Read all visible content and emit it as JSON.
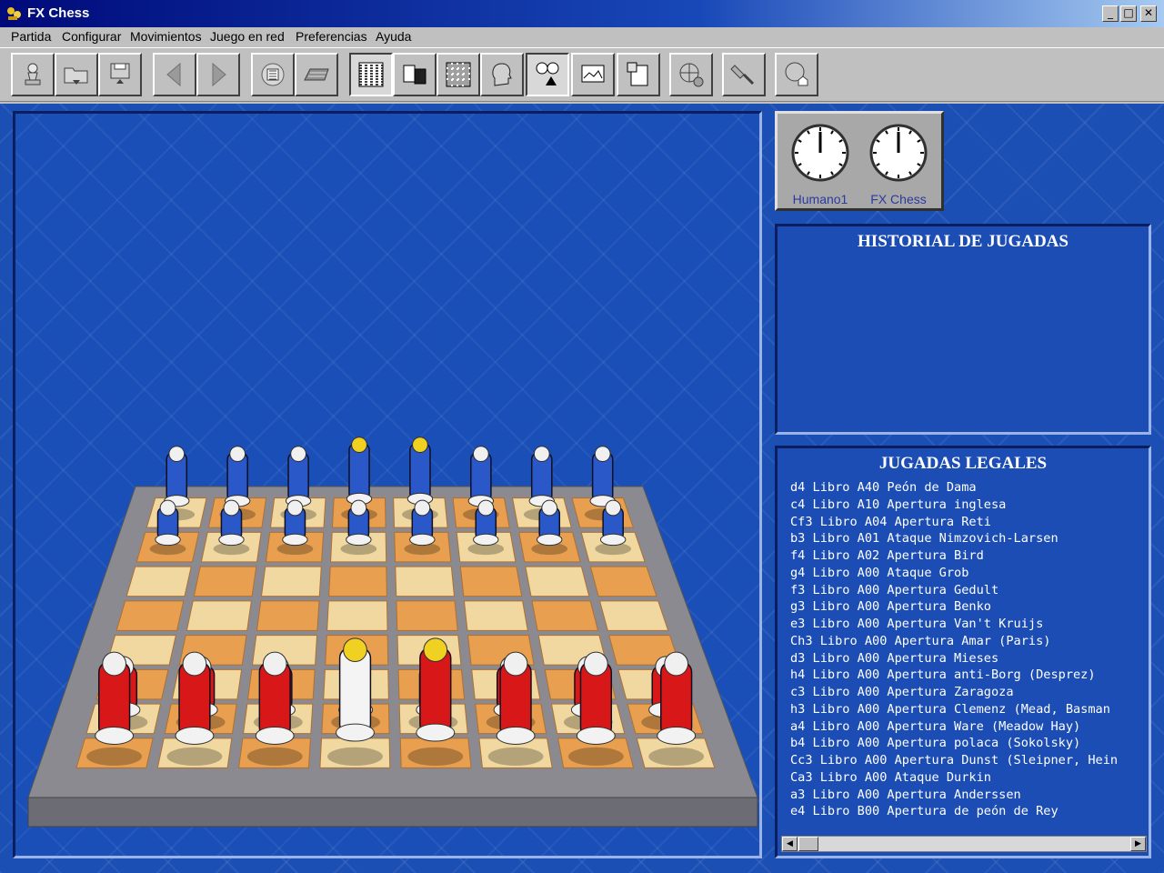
{
  "window": {
    "title": "FX Chess",
    "minimize_glyph": "_",
    "maximize_glyph": "□",
    "close_glyph": "✕"
  },
  "menu": [
    "Partida",
    "Configurar",
    "Movimientos",
    "Juego en red",
    "Preferencias",
    "Ayuda"
  ],
  "toolbar": {
    "buttons": [
      {
        "icon": "pawn-icon"
      },
      {
        "icon": "open-folder-icon"
      },
      {
        "icon": "save-disk-icon"
      },
      {
        "icon": "back-arrow-icon"
      },
      {
        "icon": "forward-arrow-icon"
      },
      {
        "icon": "chip-icon"
      },
      {
        "icon": "keyboard-icon"
      },
      {
        "icon": "board-2d-icon"
      },
      {
        "icon": "copy-pages-icon"
      },
      {
        "icon": "board-3d-icon"
      },
      {
        "icon": "head-icon"
      },
      {
        "icon": "clock-analysis-icon"
      },
      {
        "icon": "screen-icon"
      },
      {
        "icon": "clipboard-icon"
      },
      {
        "icon": "network-globe-icon"
      },
      {
        "icon": "satellite-icon"
      },
      {
        "icon": "globe-home-icon"
      }
    ]
  },
  "clocks": [
    {
      "player": "Humano1",
      "time_hours": 12,
      "time_minutes": 0
    },
    {
      "player": "FX Chess",
      "time_hours": 12,
      "time_minutes": 0
    }
  ],
  "history": {
    "title": "HISTORIAL DE JUGADAS",
    "moves": []
  },
  "legal_moves": {
    "title": "JUGADAS LEGALES",
    "items": [
      "d4  Libro A40 Peón de Dama",
      "c4  Libro A10 Apertura inglesa",
      "Cf3  Libro A04 Apertura Reti",
      "b3  Libro A01 Ataque Nimzovich-Larsen",
      "f4  Libro A02 Apertura Bird",
      "g4  Libro A00 Ataque Grob",
      "f3  Libro A00 Apertura Gedult",
      "g3  Libro A00 Apertura Benko",
      "e3  Libro A00 Apertura Van't Kruijs",
      "Ch3  Libro A00 Apertura Amar (Paris)",
      "d3  Libro A00 Apertura Mieses",
      "h4  Libro A00 Apertura anti-Borg (Desprez)",
      "c3  Libro A00 Apertura Zaragoza",
      "h3  Libro A00 Apertura Clemenz (Mead, Basman",
      "a4  Libro A00 Apertura Ware (Meadow Hay)",
      "b4  Libro A00 Apertura polaca (Sokolsky)",
      "Cc3  Libro A00 Apertura Dunst (Sleipner, Hein",
      "Ca3  Libro A00 Ataque Durkin",
      "a3  Libro A00 Apertura Anderssen",
      "e4  Libro B00 Apertura de peón de Rey"
    ],
    "scroll_left": "◀",
    "scroll_right": "▶"
  },
  "board": {
    "back_rank": [
      "rook",
      "knight",
      "bishop",
      "queen",
      "king",
      "bishop",
      "knight",
      "rook"
    ],
    "colors": {
      "white_side": "#2a58c8",
      "black_side": "#d81818",
      "light_square": "#f0d8a0",
      "dark_square": "#e8a050",
      "frame": "#8a8a90"
    }
  }
}
